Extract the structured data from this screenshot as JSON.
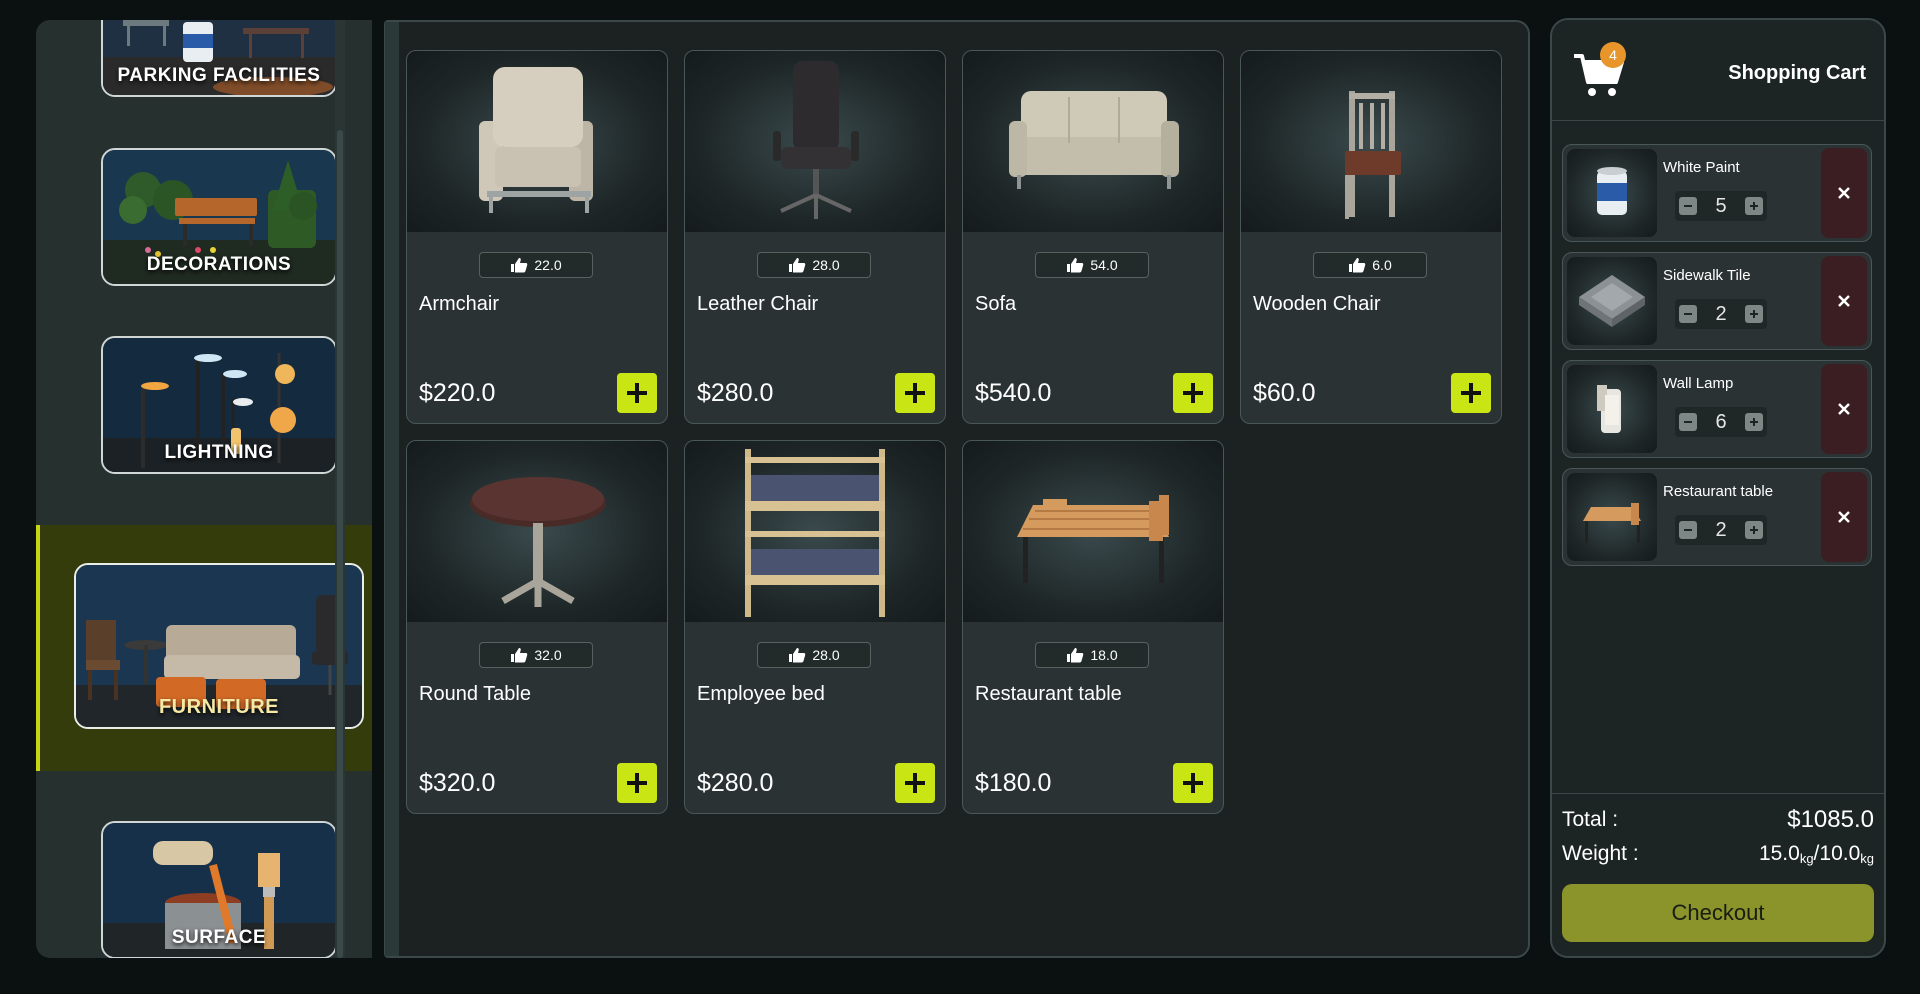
{
  "categories": [
    {
      "label": "PARKING FACILITIES",
      "active": false
    },
    {
      "label": "DECORATIONS",
      "active": false
    },
    {
      "label": "LIGHTNING",
      "active": false
    },
    {
      "label": "FURNITURE",
      "active": true
    },
    {
      "label": "SURFACE",
      "active": false
    }
  ],
  "products": [
    {
      "name": "Armchair",
      "likes": "22.0",
      "price": "$220.0"
    },
    {
      "name": "Leather Chair",
      "likes": "28.0",
      "price": "$280.0"
    },
    {
      "name": "Sofa",
      "likes": "54.0",
      "price": "$540.0"
    },
    {
      "name": "Wooden Chair",
      "likes": "6.0",
      "price": "$60.0"
    },
    {
      "name": "Round Table",
      "likes": "32.0",
      "price": "$320.0"
    },
    {
      "name": "Employee bed",
      "likes": "28.0",
      "price": "$280.0"
    },
    {
      "name": "Restaurant table",
      "likes": "18.0",
      "price": "$180.0"
    }
  ],
  "cart": {
    "title": "Shopping Cart",
    "badge_count": "4",
    "items": [
      {
        "name": "White Paint",
        "qty": "5"
      },
      {
        "name": "Sidewalk Tile",
        "qty": "2"
      },
      {
        "name": "Wall Lamp",
        "qty": "6"
      },
      {
        "name": "Restaurant table",
        "qty": "2"
      }
    ],
    "total_label": "Total :",
    "total_value": "$1085.0",
    "weight_label": "Weight :",
    "weight_current": "15.0",
    "weight_max": "10.0",
    "weight_unit": "kg",
    "checkout_label": "Checkout"
  },
  "colors": {
    "accent": "#c9e614",
    "active_category_bg": "#343c0b",
    "checkout": "#8a942a",
    "badge": "#e8962c",
    "remove_bg": "#3a1e21"
  }
}
